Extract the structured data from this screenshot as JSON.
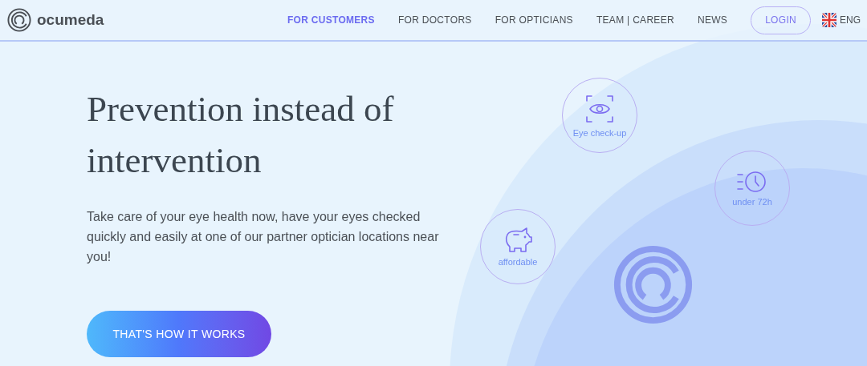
{
  "header": {
    "logo": "ocumeda",
    "nav": [
      {
        "label": "FOR CUSTOMERS",
        "selected": true
      },
      {
        "label": "FOR DOCTORS",
        "selected": false
      },
      {
        "label": "FOR OPTICIANS",
        "selected": false
      },
      {
        "label": "TEAM | CAREER",
        "selected": false
      },
      {
        "label": "NEWS",
        "selected": false
      }
    ],
    "login": "LOGIN",
    "language": "ENG"
  },
  "hero": {
    "title": "Prevention instead of intervention",
    "text": "Take care of your eye health now, have your eyes checked quickly and easily at one of our partner optician locations near you!",
    "button": "THAT'S HOW IT WORKS"
  },
  "features": [
    {
      "kind": "eye",
      "label": "Eye check-up"
    },
    {
      "kind": "clock",
      "label": "under 72h"
    },
    {
      "kind": "piggy",
      "label": "affordable"
    }
  ]
}
